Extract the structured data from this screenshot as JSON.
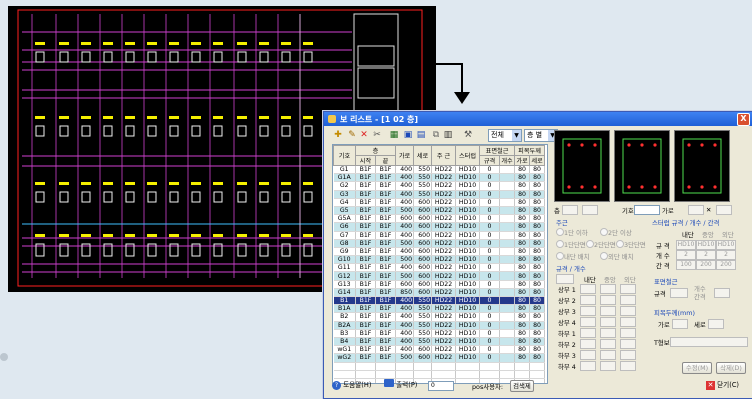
{
  "window": {
    "title": "보 리스트 - [1 02 층]",
    "close_label": "X"
  },
  "toolbar": {
    "select_all": "전체",
    "select_type": "층 별"
  },
  "table": {
    "headers_top": [
      "기호",
      "층",
      "",
      "가로",
      "세로",
      "주 근",
      "스터럽",
      "표면철근",
      "",
      "피복두께",
      ""
    ],
    "headers_sub": [
      "시작",
      "끝",
      "규격",
      "개수",
      "가로",
      "세로"
    ],
    "rows": [
      [
        "G1",
        "B1F",
        "B1F",
        "400",
        "550",
        "HD22",
        "HD10",
        "0",
        "80",
        "80"
      ],
      [
        "G1A",
        "B1F",
        "B1F",
        "400",
        "550",
        "HD22",
        "HD10",
        "0",
        "80",
        "80"
      ],
      [
        "G2",
        "B1F",
        "B1F",
        "400",
        "550",
        "HD22",
        "HD10",
        "0",
        "80",
        "80"
      ],
      [
        "G3",
        "B1F",
        "B1F",
        "400",
        "550",
        "HD22",
        "HD10",
        "0",
        "80",
        "80"
      ],
      [
        "G4",
        "B1F",
        "B1F",
        "400",
        "600",
        "HD22",
        "HD10",
        "0",
        "80",
        "80"
      ],
      [
        "G5",
        "B1F",
        "B1F",
        "500",
        "600",
        "HD22",
        "HD10",
        "0",
        "80",
        "80"
      ],
      [
        "G5A",
        "B1F",
        "B1F",
        "600",
        "600",
        "HD22",
        "HD10",
        "0",
        "80",
        "80"
      ],
      [
        "G6",
        "B1F",
        "B1F",
        "400",
        "600",
        "HD22",
        "HD10",
        "0",
        "80",
        "80"
      ],
      [
        "G7",
        "B1F",
        "B1F",
        "400",
        "600",
        "HD22",
        "HD10",
        "0",
        "80",
        "80"
      ],
      [
        "G8",
        "B1F",
        "B1F",
        "500",
        "600",
        "HD22",
        "HD10",
        "0",
        "80",
        "80"
      ],
      [
        "G9",
        "B1F",
        "B1F",
        "400",
        "600",
        "HD22",
        "HD10",
        "0",
        "80",
        "80"
      ],
      [
        "G10",
        "B1F",
        "B1F",
        "500",
        "600",
        "HD22",
        "HD10",
        "0",
        "80",
        "80"
      ],
      [
        "G11",
        "B1F",
        "B1F",
        "400",
        "600",
        "HD22",
        "HD10",
        "0",
        "80",
        "80"
      ],
      [
        "G12",
        "B1F",
        "B1F",
        "500",
        "600",
        "HD22",
        "HD10",
        "0",
        "80",
        "80"
      ],
      [
        "G13",
        "B1F",
        "B1F",
        "600",
        "600",
        "HD22",
        "HD10",
        "0",
        "80",
        "80"
      ],
      [
        "G14",
        "B1F",
        "B1F",
        "850",
        "600",
        "HD22",
        "HD10",
        "0",
        "80",
        "80"
      ],
      [
        "B1",
        "B1F",
        "B1F",
        "400",
        "550",
        "HD22",
        "HD10",
        "0",
        "80",
        "80"
      ],
      [
        "B1A",
        "B1F",
        "B1F",
        "400",
        "550",
        "HD22",
        "HD10",
        "0",
        "80",
        "80"
      ],
      [
        "B2",
        "B1F",
        "B1F",
        "400",
        "550",
        "HD22",
        "HD10",
        "0",
        "80",
        "80"
      ],
      [
        "B2A",
        "B1F",
        "B1F",
        "400",
        "550",
        "HD22",
        "HD10",
        "0",
        "80",
        "80"
      ],
      [
        "B3",
        "B1F",
        "B1F",
        "400",
        "550",
        "HD22",
        "HD10",
        "0",
        "80",
        "80"
      ],
      [
        "B4",
        "B1F",
        "B1F",
        "400",
        "550",
        "HD22",
        "HD10",
        "0",
        "80",
        "80"
      ],
      [
        "wG1",
        "B1F",
        "B1F",
        "400",
        "600",
        "HD22",
        "HD10",
        "0",
        "80",
        "80"
      ],
      [
        "wG2",
        "B1F",
        "B1F",
        "500",
        "600",
        "HD22",
        "HD10",
        "0",
        "80",
        "80"
      ]
    ],
    "selected_row": 16
  },
  "panel": {
    "position_label": "층",
    "start_label": "시작",
    "end_label": "끝",
    "symbol_label": "기호",
    "width_label": "가로",
    "depth_label": "세로",
    "main_bar_title": "주근",
    "stirrup_title": "스터럽 규격 / 개수 / 간격",
    "opt1": "1단 이하",
    "opt2": "2단 이상",
    "opt3": "1단단면",
    "opt4": "2단단면",
    "opt5": "3단단면",
    "opt6": "내단 배치",
    "opt7": "외단 배치",
    "bar_spec_title": "규격 / 개수",
    "col_inner": "내단",
    "col_mid": "중앙",
    "col_outer": "외단",
    "rows_top": [
      "상부 1",
      "상부 2",
      "상부 3",
      "상부 4"
    ],
    "rows_bot": [
      "하부 1",
      "하부 2",
      "하부 3",
      "하부 4"
    ],
    "stir_rows": [
      "규 격",
      "개 수",
      "간 격"
    ],
    "stir_cols": [
      "내단",
      "중앙",
      "외단"
    ],
    "stir_spec_vals": [
      "HD10",
      "HD10",
      "HD10"
    ],
    "stir_count_vals": [
      "2",
      "2",
      "2"
    ],
    "stir_spacing_vals": [
      "100",
      "200",
      "200"
    ],
    "surface_title": "표면철근",
    "surface_spec": "규격",
    "surface_count": "개수",
    "surface_interval": "간격",
    "cover_title": "피복두께(mm)",
    "cover_w": "가로",
    "cover_h": "세로",
    "t_label": "T형보",
    "btn_modify": "수정(M)",
    "btn_delete": "삭제(D)"
  },
  "footer": {
    "help": "도움말(H)",
    "print": "출력(P)",
    "print_val": "0",
    "pos_label": "pos사용자:",
    "pos_btn": "검색제",
    "close": "닫기(C)"
  },
  "colors": {
    "selected_row": "#24398c",
    "alt_row": "#c7e6ec",
    "title_bar": "#2a6be0"
  }
}
